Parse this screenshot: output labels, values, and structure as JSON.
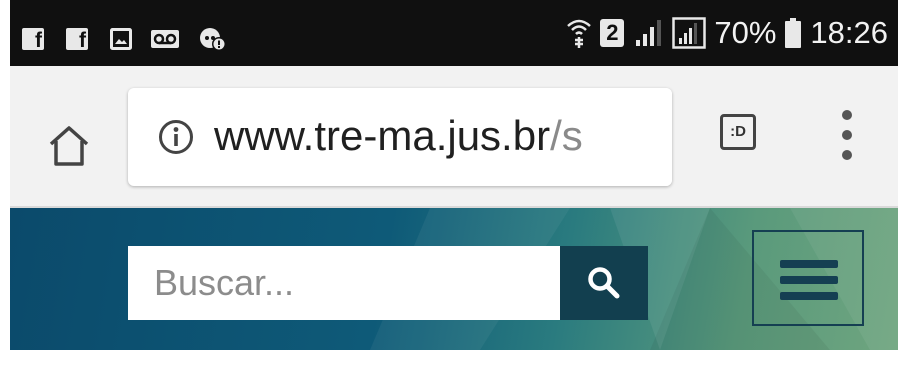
{
  "status_bar": {
    "left_icons": [
      "facebook-icon",
      "facebook-icon",
      "image-icon",
      "voicemail-icon",
      "notification-icon"
    ],
    "right_icons": [
      "wifi-calling-icon",
      "sim-2-icon",
      "signal-icon",
      "signal-icon"
    ],
    "sim_label": "2",
    "battery_percent": "70%",
    "time": "18:26"
  },
  "toolbar": {
    "url_host": "www.tre-ma.jus.br",
    "url_rest": "/s",
    "tab_switcher_label": ":D"
  },
  "site_header": {
    "search_placeholder": "Buscar...",
    "colors": {
      "gradient_start": "#0b4a6b",
      "gradient_end": "#6fa57f",
      "search_button": "#123f4f",
      "menu_icon": "#153f52"
    }
  }
}
